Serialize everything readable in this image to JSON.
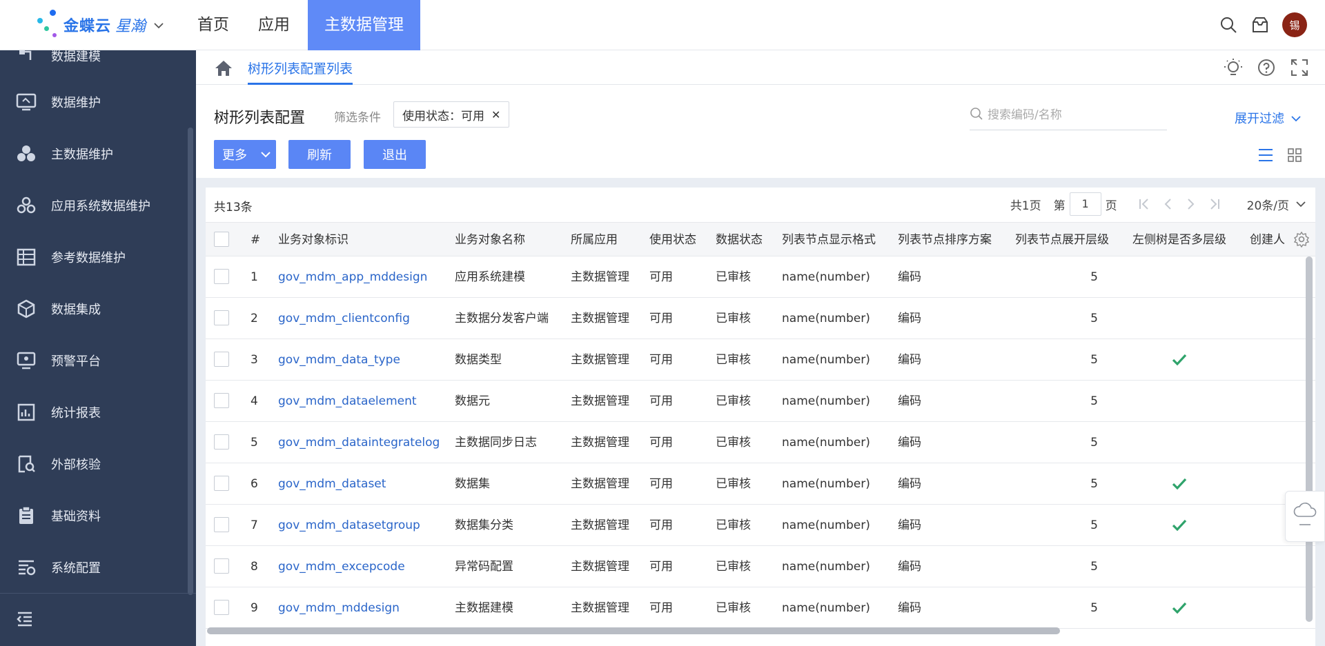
{
  "brand": {
    "name": "金蝶云",
    "product": "星瀚"
  },
  "topnav": [
    {
      "label": "首页",
      "active": false
    },
    {
      "label": "应用",
      "active": false
    },
    {
      "label": "主数据管理",
      "active": true
    }
  ],
  "user": {
    "avatar_text": "锡"
  },
  "sidebar": {
    "items": [
      {
        "label": "数据建模",
        "icon": "model-icon"
      },
      {
        "label": "数据维护",
        "icon": "monitor-icon"
      },
      {
        "label": "主数据维护",
        "icon": "circles-icon"
      },
      {
        "label": "应用系统数据维护",
        "icon": "app-data-icon"
      },
      {
        "label": "参考数据维护",
        "icon": "table-icon"
      },
      {
        "label": "数据集成",
        "icon": "cube-icon"
      },
      {
        "label": "预警平台",
        "icon": "alert-icon"
      },
      {
        "label": "统计报表",
        "icon": "chart-icon"
      },
      {
        "label": "外部核验",
        "icon": "verify-icon"
      },
      {
        "label": "基础资料",
        "icon": "clipboard-icon"
      },
      {
        "label": "系统配置",
        "icon": "config-icon"
      }
    ]
  },
  "breadcrumb": {
    "tab": "树形列表配置列表"
  },
  "header": {
    "title": "树形列表配置",
    "filter_label": "筛选条件",
    "filter_chip": "使用状态：可用",
    "search_placeholder": "搜索编码/名称",
    "expand_filter": "展开过滤",
    "buttons": {
      "more": "更多",
      "refresh": "刷新",
      "exit": "退出"
    }
  },
  "table": {
    "total": "共13条",
    "pager": {
      "pages": "共1页",
      "page_prefix": "第",
      "page": "1",
      "page_suffix": "页",
      "page_size": "20条/页"
    },
    "columns": [
      "#",
      "业务对象标识",
      "业务对象名称",
      "所属应用",
      "使用状态",
      "数据状态",
      "列表节点显示格式",
      "列表节点排序方案",
      "列表节点展开层级",
      "左侧树是否多层级",
      "创建人"
    ],
    "rows": [
      {
        "n": "1",
        "id": "gov_mdm_app_mddesign",
        "name": "应用系统建模",
        "app": "主数据管理",
        "use": "可用",
        "status": "已审核",
        "format": "name(number)",
        "sort": "编码",
        "level": "5",
        "multi": false
      },
      {
        "n": "2",
        "id": "gov_mdm_clientconfig",
        "name": "主数据分发客户端",
        "app": "主数据管理",
        "use": "可用",
        "status": "已审核",
        "format": "name(number)",
        "sort": "编码",
        "level": "5",
        "multi": false
      },
      {
        "n": "3",
        "id": "gov_mdm_data_type",
        "name": "数据类型",
        "app": "主数据管理",
        "use": "可用",
        "status": "已审核",
        "format": "name(number)",
        "sort": "编码",
        "level": "5",
        "multi": true
      },
      {
        "n": "4",
        "id": "gov_mdm_dataelement",
        "name": "数据元",
        "app": "主数据管理",
        "use": "可用",
        "status": "已审核",
        "format": "name(number)",
        "sort": "编码",
        "level": "5",
        "multi": false
      },
      {
        "n": "5",
        "id": "gov_mdm_dataintegratelog",
        "name": "主数据同步日志",
        "app": "主数据管理",
        "use": "可用",
        "status": "已审核",
        "format": "name(number)",
        "sort": "编码",
        "level": "5",
        "multi": false
      },
      {
        "n": "6",
        "id": "gov_mdm_dataset",
        "name": "数据集",
        "app": "主数据管理",
        "use": "可用",
        "status": "已审核",
        "format": "name(number)",
        "sort": "编码",
        "level": "5",
        "multi": true
      },
      {
        "n": "7",
        "id": "gov_mdm_datasetgroup",
        "name": "数据集分类",
        "app": "主数据管理",
        "use": "可用",
        "status": "已审核",
        "format": "name(number)",
        "sort": "编码",
        "level": "5",
        "multi": true
      },
      {
        "n": "8",
        "id": "gov_mdm_excepcode",
        "name": "异常码配置",
        "app": "主数据管理",
        "use": "可用",
        "status": "已审核",
        "format": "name(number)",
        "sort": "编码",
        "level": "5",
        "multi": false
      },
      {
        "n": "9",
        "id": "gov_mdm_mddesign",
        "name": "主数据建模",
        "app": "主数据管理",
        "use": "可用",
        "status": "已审核",
        "format": "name(number)",
        "sort": "编码",
        "level": "5",
        "multi": true
      }
    ]
  },
  "colors": {
    "accent": "#5a86f5",
    "link": "#2a65c9",
    "sidebar": "#2f3d57",
    "check": "#2fa36b"
  }
}
